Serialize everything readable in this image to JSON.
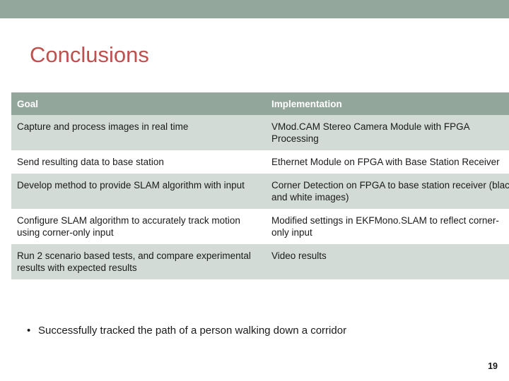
{
  "slide": {
    "title": "Conclusions",
    "page_number": "19",
    "accent_color": "#c0504d",
    "band_color": "#94a79c",
    "header_color": "#93a69b",
    "row_shade_color": "#d3dbd6"
  },
  "table": {
    "headers": [
      "Goal",
      "Implementation"
    ],
    "rows": [
      {
        "goal": "Capture and process images in real time",
        "implementation": "VMod.CAM Stereo Camera Module with FPGA Processing"
      },
      {
        "goal": "Send resulting data to base station",
        "implementation": "Ethernet Module on FPGA with Base Station Receiver"
      },
      {
        "goal": "Develop method to provide SLAM algorithm with input",
        "implementation": "Corner Detection on FPGA to base station receiver (black and white images)"
      },
      {
        "goal": "Configure SLAM algorithm to accurately track motion using corner-only input",
        "implementation": "Modified settings in EKFMono.SLAM to reflect corner-only input"
      },
      {
        "goal": "Run 2 scenario based tests, and compare experimental results with expected results",
        "implementation": "Video results"
      }
    ]
  },
  "bullets": [
    {
      "marker": "•",
      "text": "Successfully tracked the path of a person walking down a corridor"
    }
  ]
}
